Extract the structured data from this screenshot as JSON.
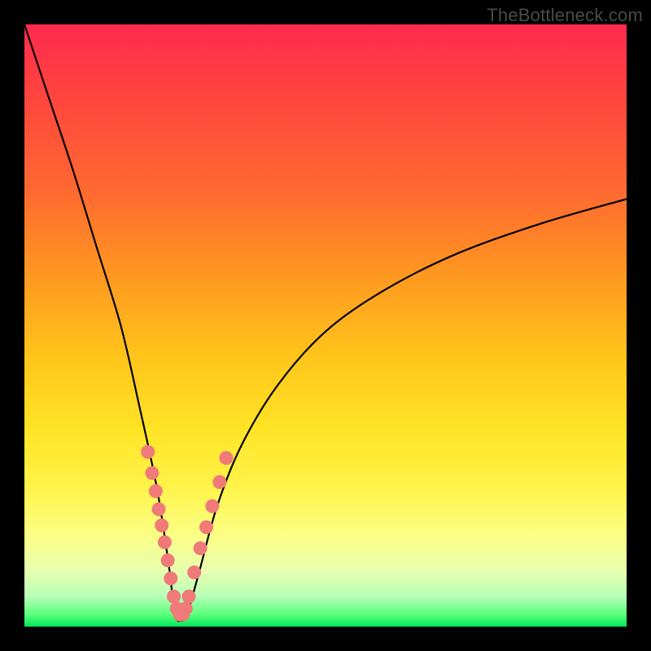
{
  "watermark": "TheBottleneck.com",
  "colors": {
    "frame": "#000000",
    "curve_stroke": "#000000",
    "scatter_fill": "#ef7a79",
    "gradient_top": "#ff2a4f",
    "gradient_bottom": "#00e85a"
  },
  "chart_data": {
    "type": "line",
    "title": "",
    "xlabel": "",
    "ylabel": "",
    "x_range": [
      0,
      100
    ],
    "y_range": [
      0,
      100
    ],
    "curve_description": "V-shaped bottleneck curve. Left branch falls steeply from top toward a minimum near x≈25, right branch rises with decreasing slope toward upper right.",
    "series": [
      {
        "name": "bottleneck-curve",
        "x": [
          0,
          4,
          8,
          12,
          16,
          19,
          22,
          24,
          25,
          26,
          27,
          29,
          32,
          36,
          42,
          50,
          60,
          72,
          86,
          100
        ],
        "values": [
          100,
          88,
          76,
          63,
          50,
          37,
          23,
          10,
          2,
          1,
          2,
          9,
          20,
          30,
          40,
          49,
          56,
          62,
          67,
          71
        ]
      },
      {
        "name": "scatter-points",
        "x": [
          20.5,
          21.2,
          21.8,
          22.3,
          22.8,
          23.3,
          23.8,
          24.3,
          24.8,
          25.3,
          25.8,
          26.3,
          26.8,
          27.3,
          28.2,
          29.2,
          30.2,
          31.2,
          32.4,
          33.5
        ],
        "values": [
          29,
          25.5,
          22.5,
          19.5,
          16.8,
          14,
          11,
          8,
          5,
          3,
          2,
          2,
          3,
          5,
          9,
          13,
          16.5,
          20,
          24,
          28
        ]
      }
    ]
  }
}
